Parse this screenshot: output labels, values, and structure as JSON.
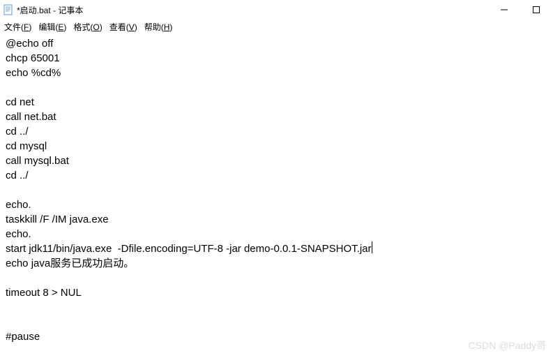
{
  "window": {
    "title": "*启动.bat - 记事本"
  },
  "menu": {
    "file": "文件(F)",
    "edit": "编辑(E)",
    "format": "格式(O)",
    "view": "查看(V)",
    "help": "帮助(H)"
  },
  "content": {
    "lines": [
      "@echo off",
      "chcp 65001",
      "echo %cd%",
      "",
      "cd net",
      "call net.bat",
      "cd ../",
      "cd mysql",
      "call mysql.bat",
      "cd ../",
      "",
      "echo.",
      "taskkill /F /IM java.exe",
      "echo.",
      "start jdk11/bin/java.exe  -Dfile.encoding=UTF-8 -jar demo-0.0.1-SNAPSHOT.jar",
      "echo java服务已成功启动。",
      "",
      "timeout 8 > NUL",
      "",
      "",
      "#pause"
    ],
    "cursor_line": 14
  },
  "watermark": "CSDN @Paddy哥"
}
